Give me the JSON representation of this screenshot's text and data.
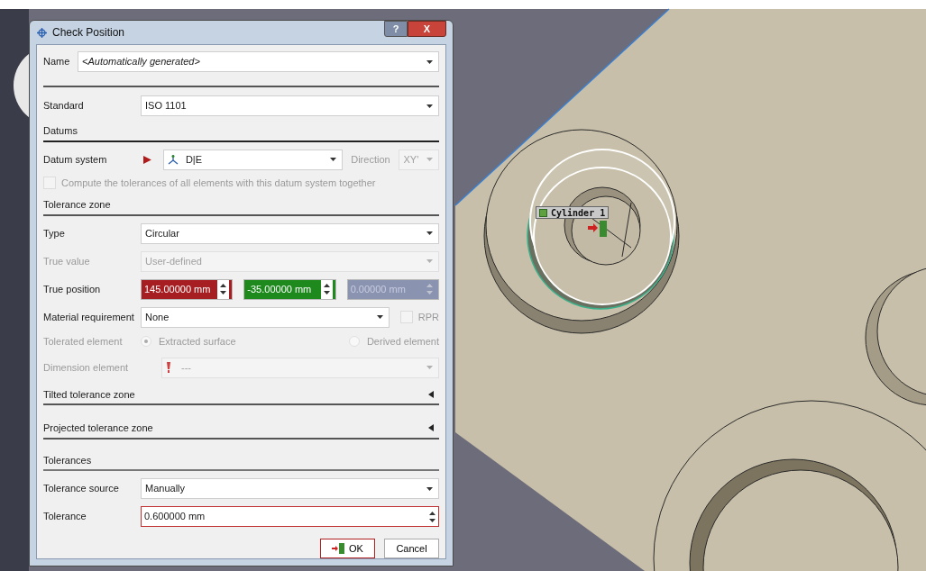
{
  "window": {
    "title": "Check Position",
    "help": "?",
    "close": "X"
  },
  "name": {
    "label": "Name",
    "value": "<Automatically generated>"
  },
  "standard": {
    "label": "Standard",
    "value": "ISO 1101"
  },
  "datums": {
    "heading": "Datums",
    "datum_system": {
      "label": "Datum system",
      "value": "D|E"
    },
    "direction": {
      "label": "Direction",
      "value": "XY'",
      "disabled": true
    },
    "compute_together": {
      "label": "Compute the tolerances of all elements with this datum system together",
      "checked": false,
      "disabled": true
    }
  },
  "tolerance_zone": {
    "heading": "Tolerance zone",
    "type": {
      "label": "Type",
      "value": "Circular",
      "disabled": false
    },
    "true_value": {
      "label": "True value",
      "value": "User-defined",
      "disabled": true
    },
    "true_position": {
      "label": "True position",
      "values": [
        {
          "value": "145.00000 mm",
          "color": "#a61e22",
          "disabled": false
        },
        {
          "value": "-35.00000 mm",
          "color": "#1e8a1e",
          "disabled": false
        },
        {
          "value": "0.00000 mm",
          "color": "#8a93b0",
          "disabled": true
        }
      ]
    },
    "material_requirement": {
      "label": "Material requirement",
      "value": "None"
    },
    "rpr": {
      "label": "RPR",
      "checked": false,
      "disabled": true
    },
    "tolerated_element": {
      "label": "Tolerated element",
      "disabled": true,
      "options": [
        {
          "label": "Extracted surface",
          "selected": true
        },
        {
          "label": "Derived element",
          "selected": false
        }
      ]
    },
    "dimension_element": {
      "label": "Dimension element",
      "value": "---",
      "disabled": true
    }
  },
  "collapsible_sections": [
    {
      "heading": "Tilted tolerance zone",
      "expanded": false
    },
    {
      "heading": "Projected tolerance zone",
      "expanded": false
    }
  ],
  "tolerances": {
    "heading": "Tolerances",
    "source": {
      "label": "Tolerance source",
      "value": "Manually"
    },
    "tolerance": {
      "label": "Tolerance",
      "value": "0.600000 mm",
      "invalid": true
    }
  },
  "buttons": [
    {
      "label": "OK",
      "default": true
    },
    {
      "label": "Cancel",
      "default": false
    }
  ],
  "viewport": {
    "labels": [
      "Cylinder 1"
    ]
  }
}
